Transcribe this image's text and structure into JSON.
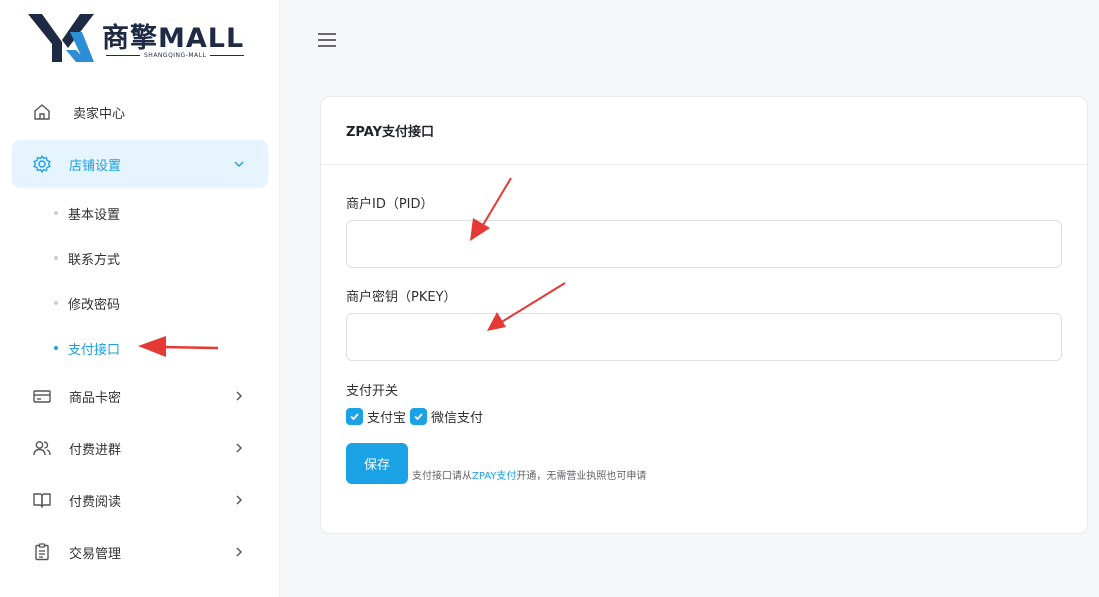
{
  "brand": {
    "name": "商擎MALL",
    "subtitle": "SHANGQING-MALL"
  },
  "sidebar": {
    "items": [
      {
        "label": "卖家中心",
        "icon": "home-icon"
      },
      {
        "label": "店铺设置",
        "icon": "gear-icon",
        "expanded": true
      },
      {
        "label": "商品卡密",
        "icon": "card-icon"
      },
      {
        "label": "付费进群",
        "icon": "users-icon"
      },
      {
        "label": "付费阅读",
        "icon": "book-icon"
      },
      {
        "label": "交易管理",
        "icon": "clipboard-icon"
      }
    ],
    "subitems": [
      {
        "label": "基本设置"
      },
      {
        "label": "联系方式"
      },
      {
        "label": "修改密码"
      },
      {
        "label": "支付接口",
        "active": true
      }
    ]
  },
  "card": {
    "title": "ZPAY支付接口",
    "pid_label": "商户ID（PID）",
    "pid_value": "",
    "pkey_label": "商户密钥（PKEY）",
    "pkey_value": "",
    "switch_label": "支付开关",
    "options": [
      {
        "label": "支付宝",
        "checked": true
      },
      {
        "label": "微信支付",
        "checked": true
      }
    ],
    "save_label": "保存",
    "hint_prefix": "支付接口请从",
    "hint_link": "ZPAY支付",
    "hint_suffix": "开通，无需营业执照也可申请"
  },
  "colors": {
    "accent": "#1aa1e6",
    "active_bg": "#e6f4fd",
    "annotation": "#e53935"
  }
}
